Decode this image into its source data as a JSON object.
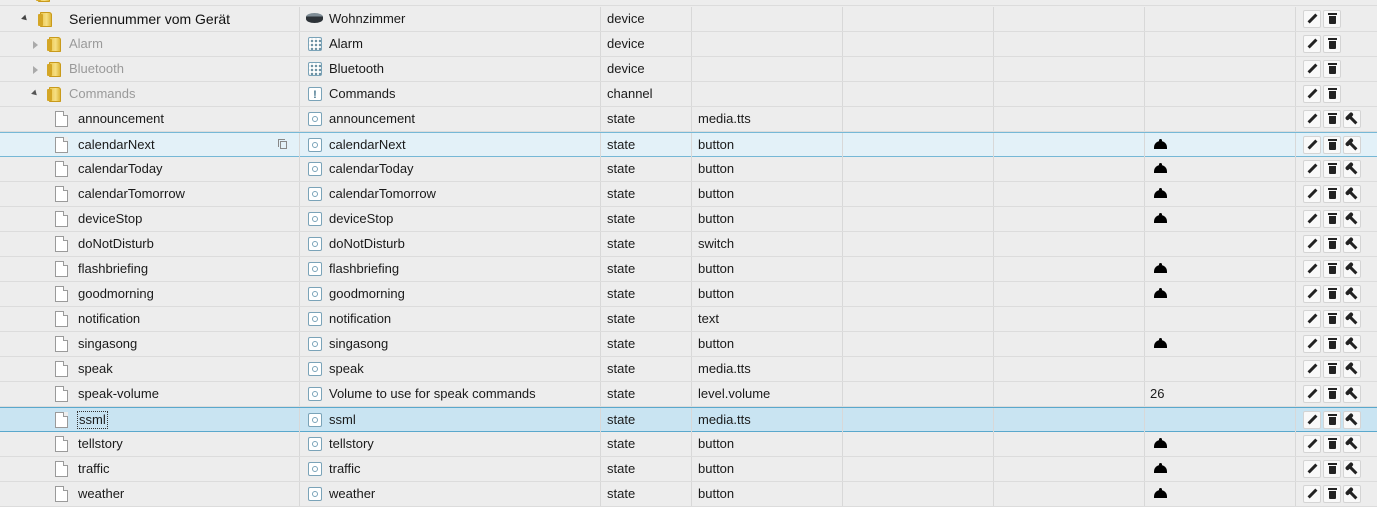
{
  "tree": {
    "device_row": {
      "name": "Seriennummer vom Gerät",
      "title": "Wohnzimmer",
      "type": "device"
    },
    "rows": [
      {
        "kind": "folder",
        "name": "Alarm",
        "title": "Alarm",
        "type": "device",
        "icon": "device-grid-icon",
        "expanded": false
      },
      {
        "kind": "folder",
        "name": "Bluetooth",
        "title": "Bluetooth",
        "type": "device",
        "icon": "device-grid-icon",
        "expanded": false
      },
      {
        "kind": "folder",
        "name": "Commands",
        "title": "Commands",
        "type": "channel",
        "icon": "channel-icon",
        "expanded": true
      },
      {
        "kind": "state",
        "name": "announcement",
        "title": "announcement",
        "type": "state",
        "role": "media.tts",
        "value": ""
      },
      {
        "kind": "state",
        "name": "calendarNext",
        "title": "calendarNext",
        "type": "state",
        "role": "button",
        "value": "bell",
        "hover": true
      },
      {
        "kind": "state",
        "name": "calendarToday",
        "title": "calendarToday",
        "type": "state",
        "role": "button",
        "value": "bell"
      },
      {
        "kind": "state",
        "name": "calendarTomorrow",
        "title": "calendarTomorrow",
        "type": "state",
        "role": "button",
        "value": "bell"
      },
      {
        "kind": "state",
        "name": "deviceStop",
        "title": "deviceStop",
        "type": "state",
        "role": "button",
        "value": "bell"
      },
      {
        "kind": "state",
        "name": "doNotDisturb",
        "title": "doNotDisturb",
        "type": "state",
        "role": "switch",
        "value": ""
      },
      {
        "kind": "state",
        "name": "flashbriefing",
        "title": "flashbriefing",
        "type": "state",
        "role": "button",
        "value": "bell"
      },
      {
        "kind": "state",
        "name": "goodmorning",
        "title": "goodmorning",
        "type": "state",
        "role": "button",
        "value": "bell"
      },
      {
        "kind": "state",
        "name": "notification",
        "title": "notification",
        "type": "state",
        "role": "text",
        "value": ""
      },
      {
        "kind": "state",
        "name": "singasong",
        "title": "singasong",
        "type": "state",
        "role": "button",
        "value": "bell"
      },
      {
        "kind": "state",
        "name": "speak",
        "title": "speak",
        "type": "state",
        "role": "media.tts",
        "value": ""
      },
      {
        "kind": "state",
        "name": "speak-volume",
        "title": "Volume to use for speak commands",
        "type": "state",
        "role": "level.volume",
        "value": "26"
      },
      {
        "kind": "state",
        "name": "ssml",
        "title": "ssml",
        "type": "state",
        "role": "media.tts",
        "value": "",
        "selected": true
      },
      {
        "kind": "state",
        "name": "tellstory",
        "title": "tellstory",
        "type": "state",
        "role": "button",
        "value": "bell"
      },
      {
        "kind": "state",
        "name": "traffic",
        "title": "traffic",
        "type": "state",
        "role": "button",
        "value": "bell"
      },
      {
        "kind": "state",
        "name": "weather",
        "title": "weather",
        "type": "state",
        "role": "button",
        "value": "bell"
      }
    ]
  },
  "icons": {
    "folder": "folder-icon",
    "file": "file-icon",
    "state": "state-icon",
    "echo": "echo-device-icon",
    "value_button": "bell-icon",
    "actions": [
      "pencil-icon",
      "trash-icon",
      "wrench-icon"
    ]
  },
  "colors": {
    "hover": "#e3f1f8",
    "selected": "#c9e4f2",
    "folder": "#e8c44a"
  }
}
